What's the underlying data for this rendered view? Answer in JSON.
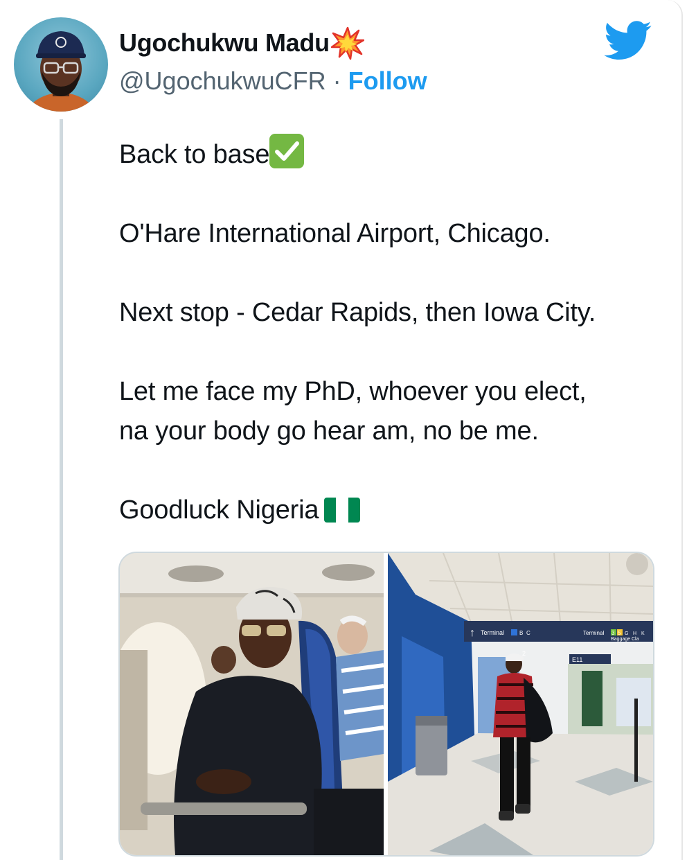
{
  "user": {
    "display_name": "Ugochukwu Madu",
    "handle": "@UgochukwuCFR",
    "separator": "·",
    "follow_label": "Follow",
    "avatar_icon": "avatar",
    "name_emoji_icon": "collision-emoji-icon"
  },
  "tweet": {
    "paragraphs": [
      "Back to base",
      "O'Hare International Airport, Chicago.",
      "Next stop - Cedar Rapids, then Iowa City.",
      "Let me face my PhD, whoever you elect,\nna your body go hear am, no be me.",
      "Goodluck Nigeria"
    ],
    "emoji": {
      "base_check": "check-mark-emoji-icon",
      "nigeria_flag": "nigeria-flag-emoji-icon"
    }
  },
  "media": {
    "left_photo": {
      "signs": []
    },
    "right_photo": {
      "signs": [
        "Terminal",
        "B",
        "C",
        "Terminal",
        "3",
        "5",
        "G",
        "H",
        "K",
        "Baggage Cla",
        "E11",
        "2"
      ]
    }
  },
  "colors": {
    "accent": "#1d9bf0",
    "text": "#0f1419",
    "secondary": "#536471",
    "thread_line": "#cfd9de"
  }
}
